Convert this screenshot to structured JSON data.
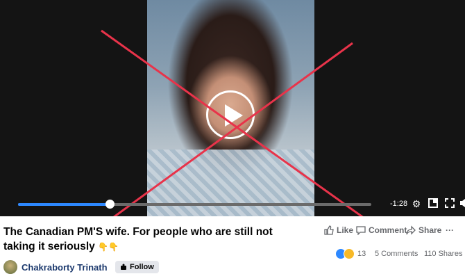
{
  "video": {
    "time_remaining": "-1:28",
    "progress": 0.26,
    "buffered": 0.5,
    "icons": [
      "play-icon",
      "settings-icon",
      "pip-icon",
      "fullscreen-icon",
      "volume-icon"
    ]
  },
  "post": {
    "title_line1": "The Canadian PM'S wife. For people who are still not",
    "title_line2": "taking it seriously",
    "title_emoji": "👇👇",
    "actions": {
      "like": "Like",
      "comment": "Comment",
      "share": "Share",
      "more": "···"
    },
    "reactions_count": "13",
    "comments_count": "5 Comments",
    "shares_count": "110 Shares",
    "author": "Chakraborty Trinath",
    "follow_label": "Follow"
  },
  "colors": {
    "progress": "#2d88ff",
    "cross": "#e8334a",
    "author_link": "#1d3a6e"
  }
}
